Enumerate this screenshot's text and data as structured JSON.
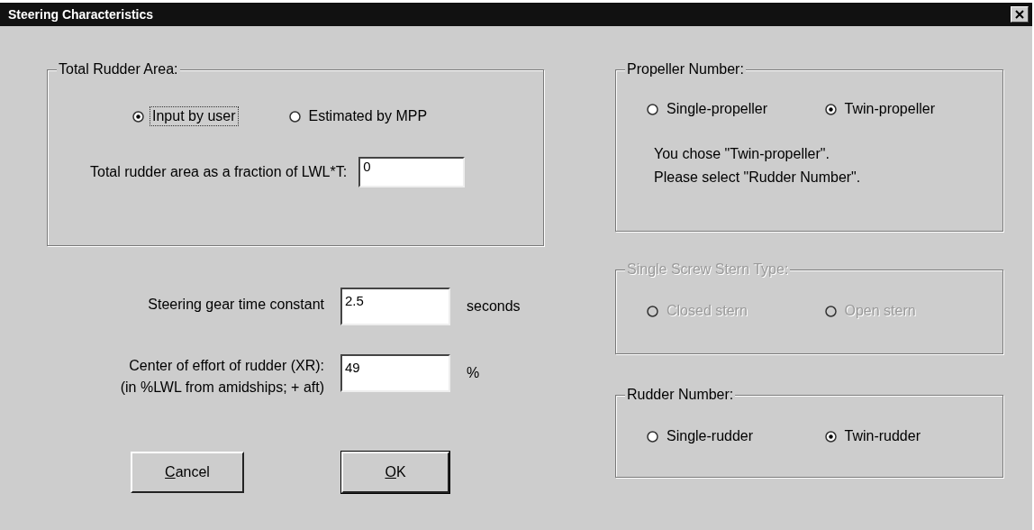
{
  "window": {
    "title": "Steering Characteristics"
  },
  "rudder_area": {
    "label": "Total Rudder Area:",
    "options": [
      {
        "label": "Input by user",
        "selected": true,
        "focused": true
      },
      {
        "label": "Estimated by MPP",
        "selected": false,
        "focused": false
      }
    ],
    "fraction": {
      "label": "Total rudder area as a fraction of LWL*T:",
      "value": "0"
    }
  },
  "time_constant": {
    "label": "Steering gear time constant",
    "value": "2.5",
    "unit": "seconds"
  },
  "center_of_effort": {
    "label": "Center of effort of rudder (XR):",
    "note": "(in %LWL from amidships; + aft)",
    "value": "49",
    "unit": "%"
  },
  "buttons": [
    {
      "label": "Cancel",
      "default": false
    },
    {
      "label": "OK",
      "default": true
    }
  ],
  "groups": [
    {
      "label": "Propeller Number:",
      "disabled": false,
      "options": [
        {
          "label": "Single-propeller",
          "selected": false
        },
        {
          "label": "Twin-propeller",
          "selected": true
        }
      ],
      "message": [
        "You chose \"Twin-propeller\".",
        "Please select \"Rudder Number\"."
      ]
    },
    {
      "label": "Single Screw Stern Type:",
      "disabled": true,
      "options": [
        {
          "label": "Closed stern",
          "selected": false
        },
        {
          "label": "Open stern",
          "selected": false
        }
      ]
    },
    {
      "label": "Rudder Number:",
      "disabled": false,
      "options": [
        {
          "label": "Single-rudder",
          "selected": false
        },
        {
          "label": "Twin-rudder",
          "selected": true
        }
      ]
    }
  ]
}
